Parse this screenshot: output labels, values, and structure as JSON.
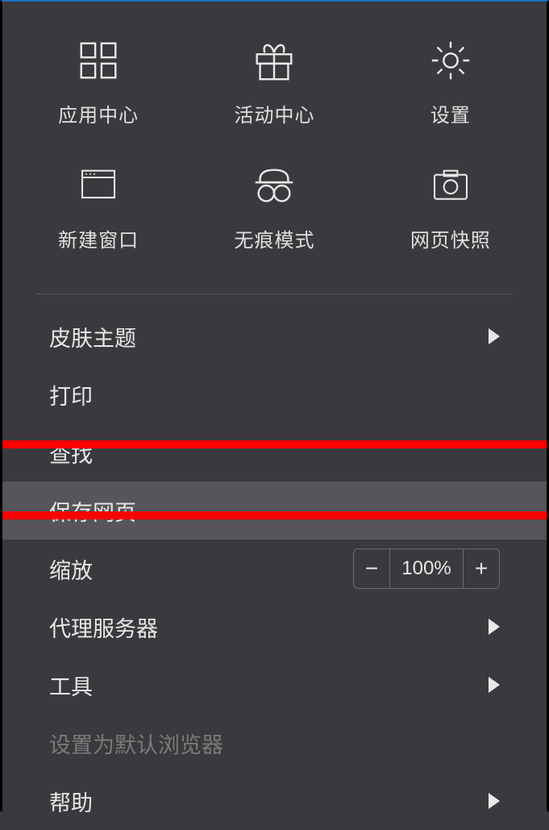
{
  "grid": [
    {
      "label": "应用中心",
      "icon": "apps"
    },
    {
      "label": "活动中心",
      "icon": "gift"
    },
    {
      "label": "设置",
      "icon": "gear"
    },
    {
      "label": "新建窗口",
      "icon": "window"
    },
    {
      "label": "无痕模式",
      "icon": "incognito"
    },
    {
      "label": "网页快照",
      "icon": "camera"
    }
  ],
  "menu": {
    "skin": "皮肤主题",
    "print": "打印",
    "find": "查找",
    "save_page": "保存网页",
    "zoom": "缩放",
    "zoom_value": "100%",
    "proxy": "代理服务器",
    "tools": "工具",
    "set_default": "设置为默认浏览器",
    "help": "帮助"
  }
}
